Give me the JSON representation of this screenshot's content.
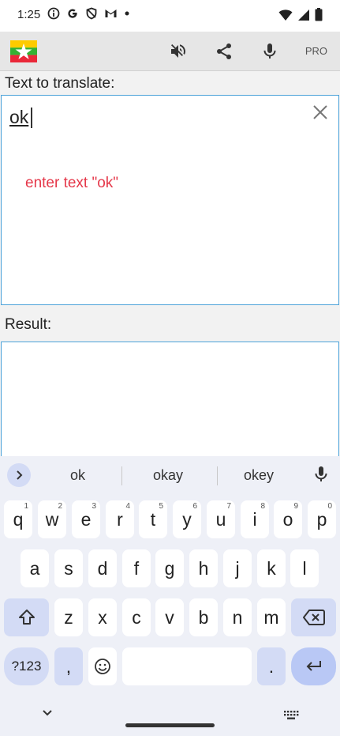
{
  "status": {
    "time": "1:25",
    "left_icons": [
      "info-icon",
      "google-icon",
      "shield-icon",
      "gmail-icon",
      "dot-icon"
    ],
    "right_icons": [
      "wifi-icon",
      "signal-icon",
      "battery-icon"
    ]
  },
  "toolbar": {
    "flag": "myanmar-flag-icon",
    "mute": "volume-off-icon",
    "share": "share-icon",
    "mic": "mic-icon",
    "pro_label": "PRO"
  },
  "input": {
    "label": "Text to translate:",
    "value": "ok",
    "hint": "enter text \"ok\""
  },
  "result": {
    "label": "Result:"
  },
  "keyboard": {
    "suggestions": [
      "ok",
      "okay",
      "okey"
    ],
    "row1": [
      {
        "k": "q",
        "n": "1"
      },
      {
        "k": "w",
        "n": "2"
      },
      {
        "k": "e",
        "n": "3"
      },
      {
        "k": "r",
        "n": "4"
      },
      {
        "k": "t",
        "n": "5"
      },
      {
        "k": "y",
        "n": "6"
      },
      {
        "k": "u",
        "n": "7"
      },
      {
        "k": "i",
        "n": "8"
      },
      {
        "k": "o",
        "n": "9"
      },
      {
        "k": "p",
        "n": "0"
      }
    ],
    "row2": [
      "a",
      "s",
      "d",
      "f",
      "g",
      "h",
      "j",
      "k",
      "l"
    ],
    "row3": [
      "z",
      "x",
      "c",
      "v",
      "b",
      "n",
      "m"
    ],
    "symbols_label": "?123",
    "comma": ",",
    "period": "."
  },
  "colors": {
    "accent_border": "#4da3d9",
    "hint_red": "#e5384a",
    "key_mod": "#d3dbf5",
    "enter_key": "#b9c8f5"
  }
}
